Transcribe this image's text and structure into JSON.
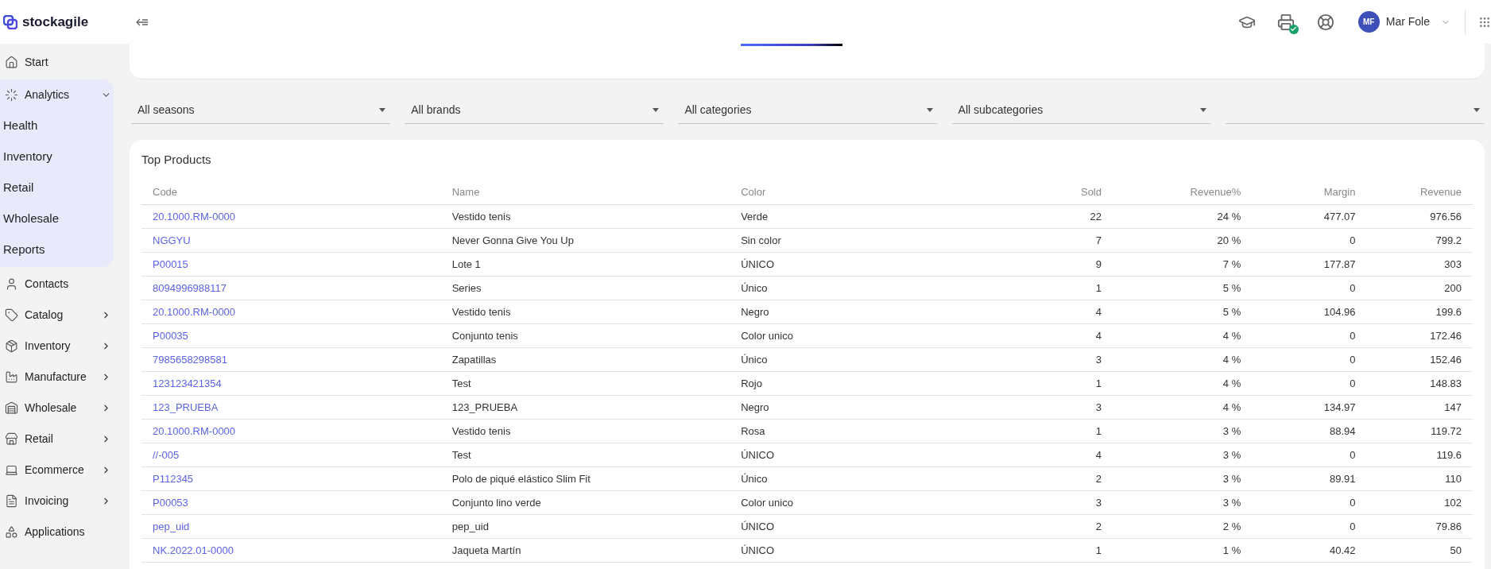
{
  "brand": {
    "name": "stockagile"
  },
  "user": {
    "initials": "MF",
    "name": "Mar Fole"
  },
  "sidebar": {
    "items": [
      {
        "kind": "link",
        "label": "Start"
      },
      {
        "kind": "group",
        "label": "Analytics",
        "expanded": true,
        "children": [
          {
            "label": "Health"
          },
          {
            "label": "Inventory"
          },
          {
            "label": "Retail"
          },
          {
            "label": "Wholesale"
          },
          {
            "label": "Reports"
          }
        ]
      },
      {
        "kind": "link",
        "label": "Contacts"
      },
      {
        "kind": "group",
        "label": "Catalog",
        "expanded": false
      },
      {
        "kind": "group",
        "label": "Inventory",
        "expanded": false
      },
      {
        "kind": "group",
        "label": "Manufacture",
        "expanded": false
      },
      {
        "kind": "group",
        "label": "Wholesale",
        "expanded": false
      },
      {
        "kind": "group",
        "label": "Retail",
        "expanded": false
      },
      {
        "kind": "group",
        "label": "Ecommerce",
        "expanded": false
      },
      {
        "kind": "group",
        "label": "Invoicing",
        "expanded": false
      },
      {
        "kind": "link",
        "label": "Applications"
      }
    ]
  },
  "filters": [
    {
      "kind": "dropdown",
      "value": "All seasons"
    },
    {
      "kind": "dropdown",
      "value": "All brands"
    },
    {
      "kind": "dropdown",
      "value": "All categories"
    },
    {
      "kind": "dropdown",
      "value": "All subcategories"
    },
    {
      "kind": "dropdown"
    }
  ],
  "table": {
    "title": "Top Products",
    "columns": [
      "Code",
      "Name",
      "Color",
      "Sold",
      "Revenue%",
      "Margin",
      "Revenue"
    ],
    "rows": [
      [
        "20.1000.RM-0000",
        "Vestido tenis",
        "Verde",
        "22",
        "24 %",
        "477.07",
        "976.56"
      ],
      [
        "NGGYU",
        "Never Gonna Give You Up",
        "Sin color",
        "7",
        "20 %",
        "0",
        "799.2"
      ],
      [
        "P00015",
        "Lote 1",
        "ÚNICO",
        "9",
        "7 %",
        "177.87",
        "303"
      ],
      [
        "8094996988117",
        "Series",
        "Único",
        "1",
        "5 %",
        "0",
        "200"
      ],
      [
        "20.1000.RM-0000",
        "Vestido tenis",
        "Negro",
        "4",
        "5 %",
        "104.96",
        "199.6"
      ],
      [
        "P00035",
        "Conjunto tenis",
        "Color unico",
        "4",
        "4 %",
        "0",
        "172.46"
      ],
      [
        "7985658298581",
        "Zapatillas",
        "Único",
        "3",
        "4 %",
        "0",
        "152.46"
      ],
      [
        "123123421354",
        "Test",
        "Rojo",
        "1",
        "4 %",
        "0",
        "148.83"
      ],
      [
        "123_PRUEBA",
        "123_PRUEBA",
        "Negro",
        "3",
        "4 %",
        "134.97",
        "147"
      ],
      [
        "20.1000.RM-0000",
        "Vestido tenis",
        "Rosa",
        "1",
        "3 %",
        "88.94",
        "119.72"
      ],
      [
        "//-005",
        "Test",
        "ÚNICO",
        "4",
        "3 %",
        "0",
        "119.6"
      ],
      [
        "P112345",
        "Polo de piqué elástico Slim Fit",
        "Único",
        "2",
        "3 %",
        "89.91",
        "110"
      ],
      [
        "P00053",
        "Conjunto lino verde",
        "Color unico",
        "3",
        "3 %",
        "0",
        "102"
      ],
      [
        "pep_uid",
        "pep_uid",
        "ÚNICO",
        "2",
        "2 %",
        "0",
        "79.86"
      ],
      [
        "NK.2022.01-0000",
        "Jaqueta Martín",
        "ÚNICO",
        "1",
        "1 %",
        "40.42",
        "50"
      ]
    ]
  }
}
